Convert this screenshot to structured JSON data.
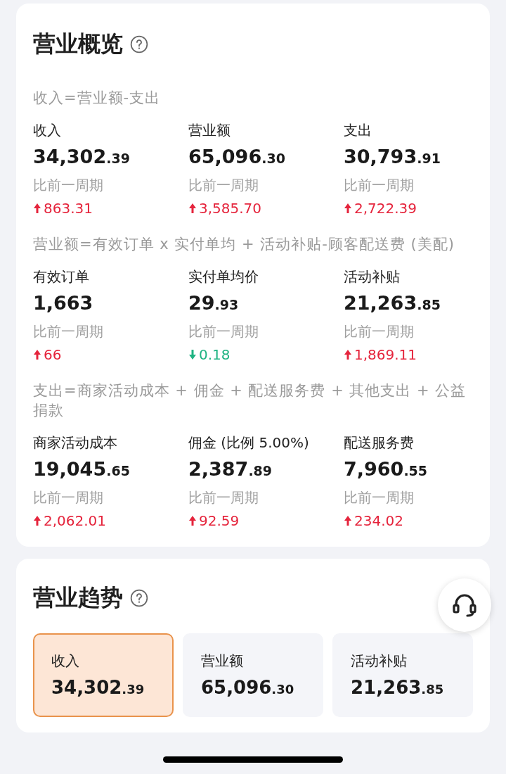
{
  "overview": {
    "title": "营业概览",
    "sections": [
      {
        "formula": "收入=营业额-支出",
        "metrics": [
          {
            "label": "收入",
            "value": "34,302.39",
            "compare_label": "比前一周期",
            "delta": "863.31",
            "down": false
          },
          {
            "label": "营业额",
            "value": "65,096.30",
            "compare_label": "比前一周期",
            "delta": "3,585.70",
            "down": false
          },
          {
            "label": "支出",
            "value": "30,793.91",
            "compare_label": "比前一周期",
            "delta": "2,722.39",
            "down": false
          }
        ]
      },
      {
        "formula": "营业额=有效订单 x 实付单均 + 活动补贴-顾客配送费 (美配)",
        "metrics": [
          {
            "label": "有效订单",
            "value": "1,663",
            "compare_label": "比前一周期",
            "delta": "66",
            "down": false
          },
          {
            "label": "实付单均价",
            "value": "29.93",
            "compare_label": "比前一周期",
            "delta": "0.18",
            "down": true
          },
          {
            "label": "活动补贴",
            "value": "21,263.85",
            "compare_label": "比前一周期",
            "delta": "1,869.11",
            "down": false
          }
        ]
      },
      {
        "formula": "支出=商家活动成本 + 佣金 + 配送服务费 + 其他支出 + 公益捐款",
        "metrics": [
          {
            "label": "商家活动成本",
            "value": "19,045.65",
            "compare_label": "比前一周期",
            "delta": "2,062.01",
            "down": false
          },
          {
            "label": "佣金 (比例 5.00%)",
            "value": "2,387.89",
            "compare_label": "比前一周期",
            "delta": "92.59",
            "down": false
          },
          {
            "label": "配送服务费",
            "value": "7,960.55",
            "compare_label": "比前一周期",
            "delta": "234.02",
            "down": false
          }
        ]
      }
    ]
  },
  "trend": {
    "title": "营业趋势",
    "tabs": [
      {
        "label": "收入",
        "value": "34,302.39",
        "selected": true
      },
      {
        "label": "营业额",
        "value": "65,096.30",
        "selected": false
      },
      {
        "label": "活动补贴",
        "value": "21,263.85",
        "selected": false
      }
    ]
  }
}
